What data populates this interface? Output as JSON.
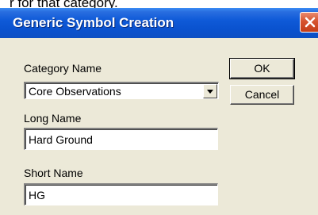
{
  "background_text": "r for that category.",
  "dialog": {
    "title": "Generic Symbol Creation",
    "close_icon": "close-icon",
    "fields": {
      "category_label": "Category Name",
      "category_value": "Core Observations",
      "long_name_label": "Long Name",
      "long_name_value": "Hard Ground",
      "short_name_label": "Short Name",
      "short_name_value": "HG"
    },
    "buttons": {
      "ok_label": "OK",
      "cancel_label": "Cancel"
    }
  },
  "colors": {
    "titlebar": "#0a52cf",
    "close_button": "#d6532e",
    "dialog_background": "#ece9d8"
  }
}
